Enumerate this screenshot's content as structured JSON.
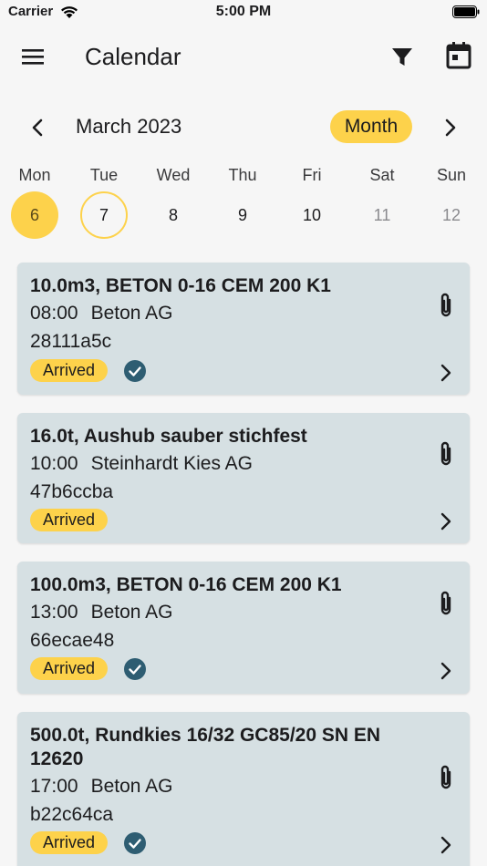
{
  "status_bar": {
    "carrier": "Carrier",
    "time": "5:00 PM"
  },
  "app_bar": {
    "title": "Calendar"
  },
  "month_nav": {
    "label": "March 2023",
    "view_mode": "Month"
  },
  "week": {
    "days": [
      {
        "name": "Mon",
        "num": "6"
      },
      {
        "name": "Tue",
        "num": "7"
      },
      {
        "name": "Wed",
        "num": "8"
      },
      {
        "name": "Thu",
        "num": "9"
      },
      {
        "name": "Fri",
        "num": "10"
      },
      {
        "name": "Sat",
        "num": "11"
      },
      {
        "name": "Sun",
        "num": "12"
      }
    ]
  },
  "deliveries": [
    {
      "title": "10.0m3, BETON 0-16 CEM 200 K1",
      "time": "08:00",
      "supplier": "Beton AG",
      "code": "28111a5c",
      "status": "Arrived"
    },
    {
      "title": "16.0t, Aushub sauber stichfest",
      "time": "10:00",
      "supplier": "Steinhardt Kies AG",
      "code": "47b6ccba",
      "status": "Arrived"
    },
    {
      "title": "100.0m3, BETON 0-16 CEM 200 K1",
      "time": "13:00",
      "supplier": "Beton AG",
      "code": "66ecae48",
      "status": "Arrived"
    },
    {
      "title": "500.0t, Rundkies 16/32 GC85/20 SN EN 12620",
      "time": "17:00",
      "supplier": "Beton AG",
      "code": "b22c64ca",
      "status": "Arrived"
    }
  ],
  "colors": {
    "accent": "#fdd24b",
    "card_bg": "#d6e0e3",
    "check": "#2e5d72"
  }
}
